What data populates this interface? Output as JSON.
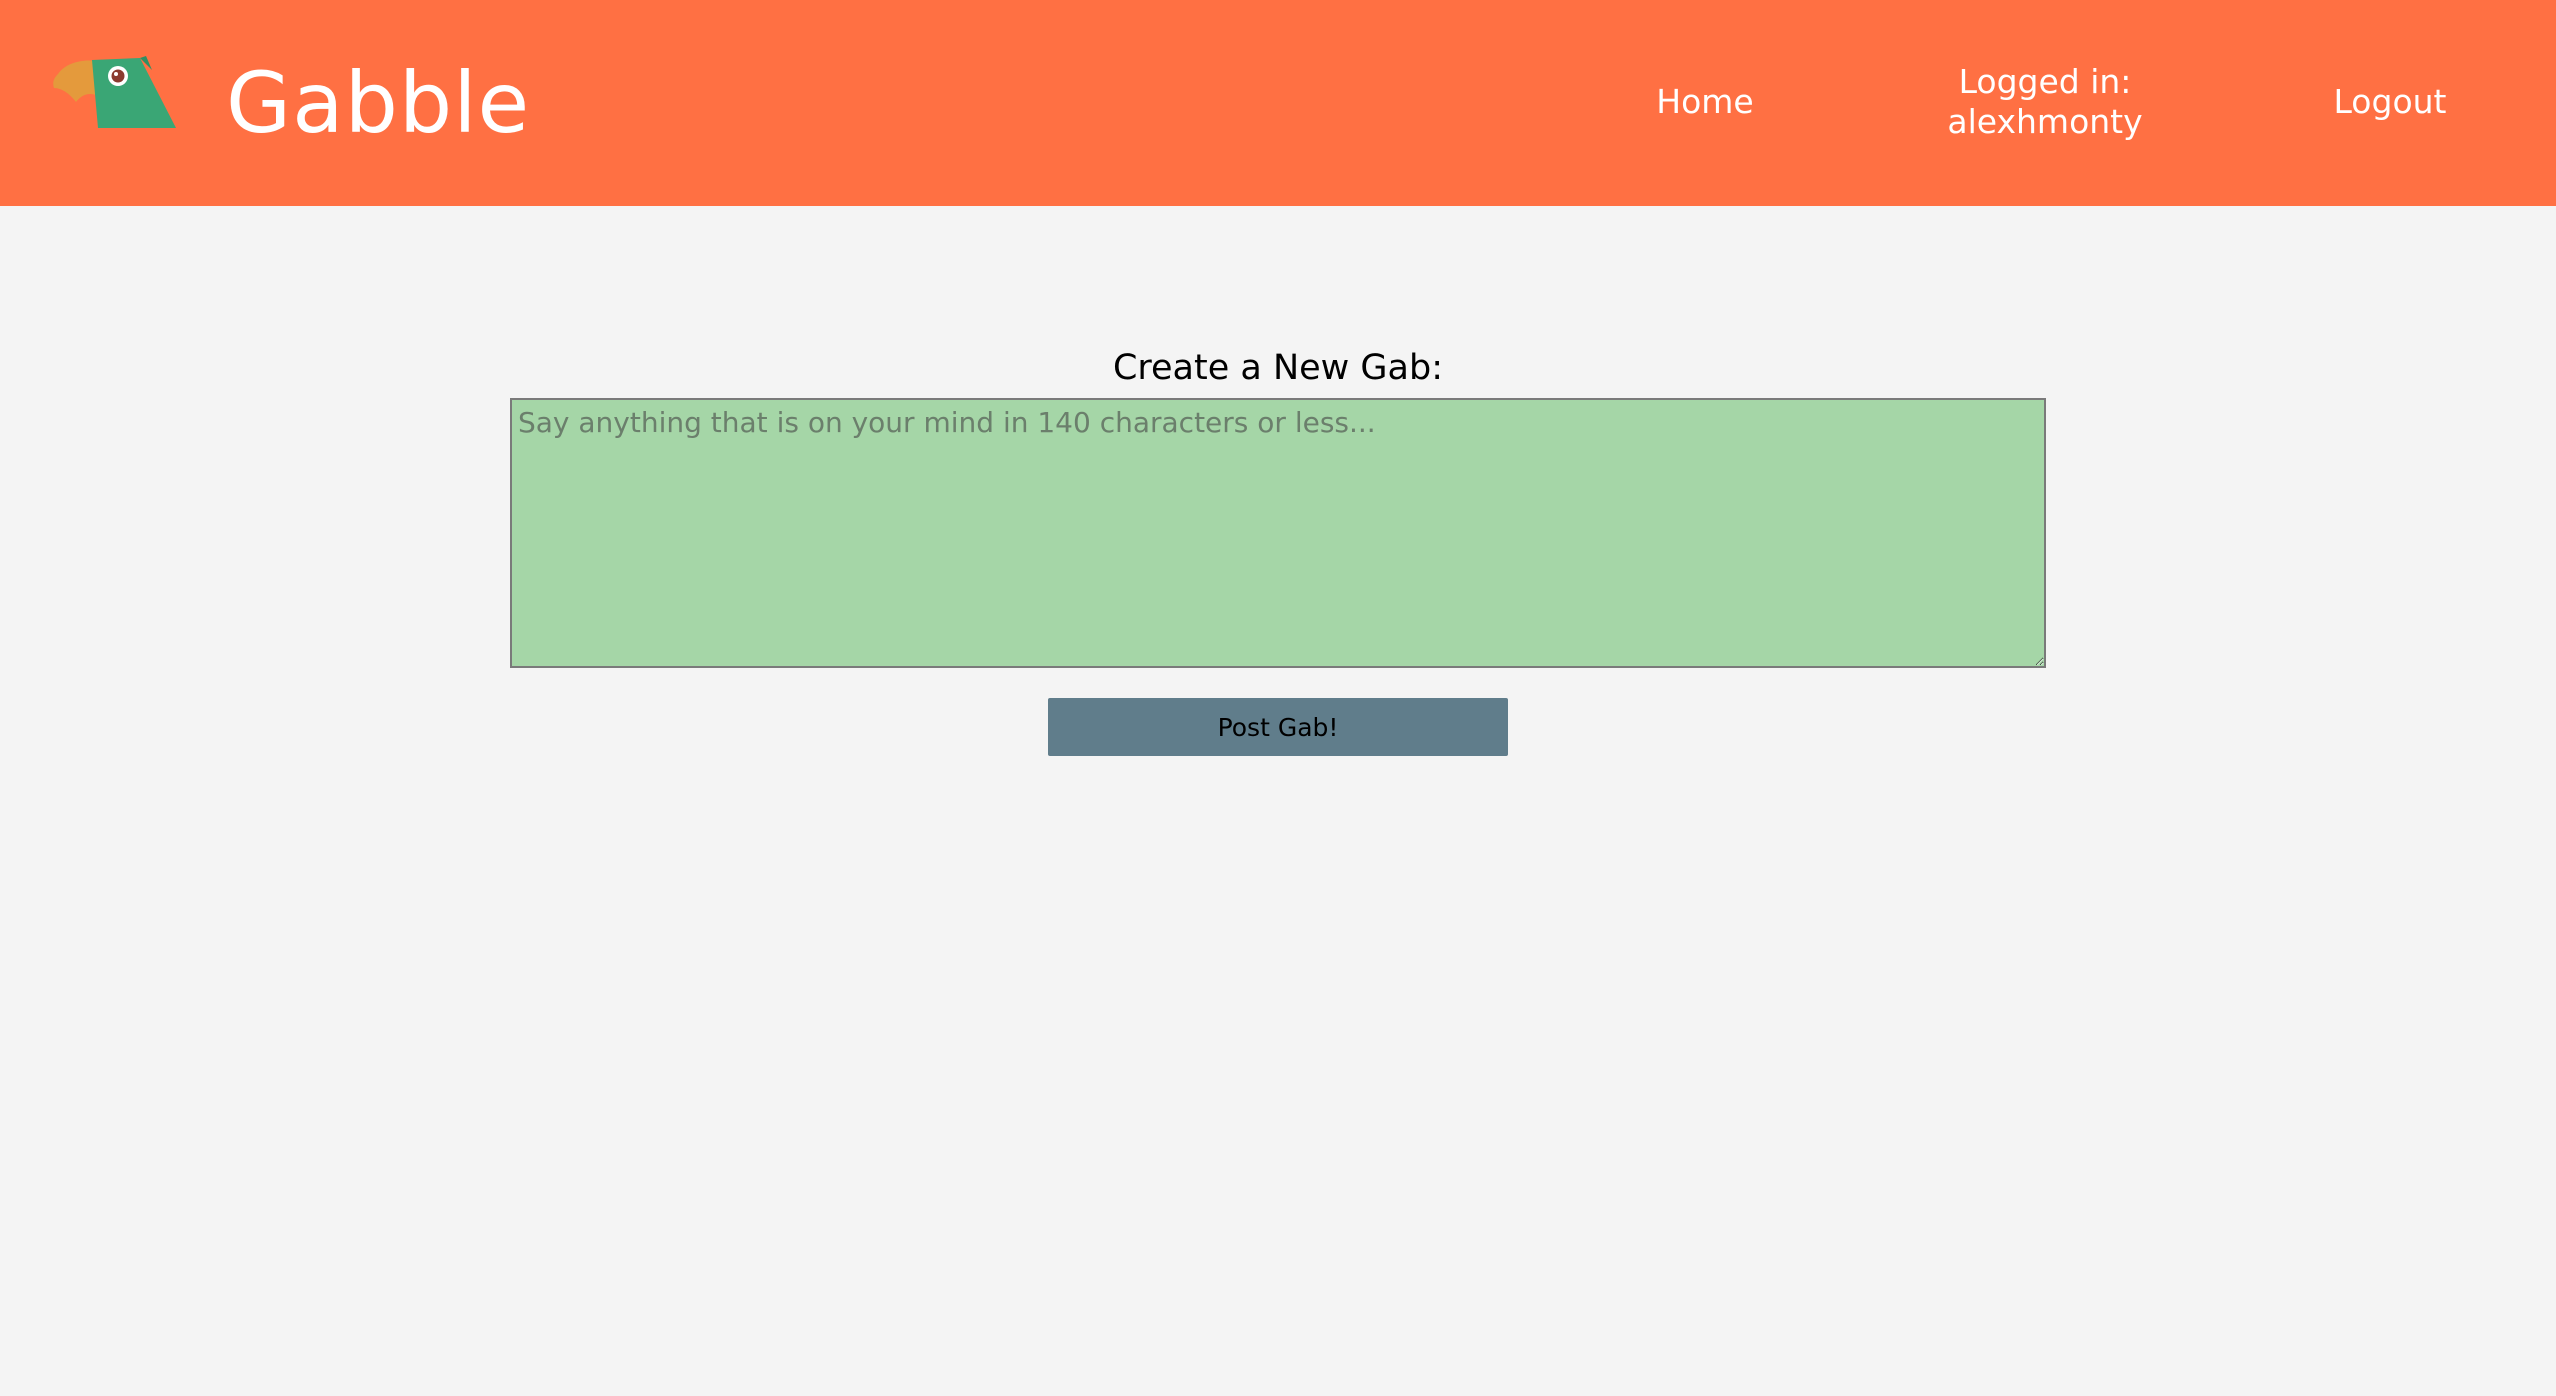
{
  "colors": {
    "header_bg": "#ff7043",
    "page_bg": "#f4f4f4",
    "input_bg": "#a5d6a7",
    "button_bg": "#607d8b"
  },
  "header": {
    "logo_icon": "parrot-icon",
    "brand": "Gabble",
    "nav": {
      "home": "Home",
      "logged_in_label": "Logged in:",
      "username": "alexhmonty",
      "logout": "Logout"
    }
  },
  "compose": {
    "title": "Create a New Gab:",
    "placeholder": "Say anything that is on your mind in 140 characters or less...",
    "value": "",
    "submit_label": "Post Gab!"
  }
}
